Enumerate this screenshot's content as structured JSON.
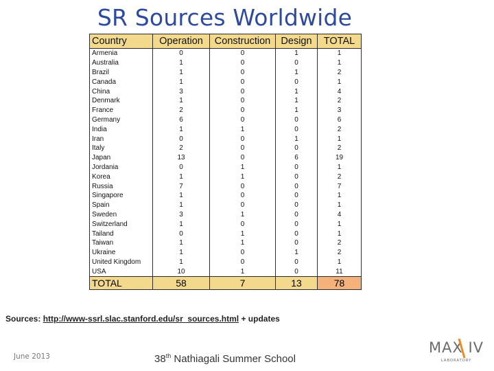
{
  "slide": {
    "title": "SR Sources Worldwide",
    "sources_label": "Sources:",
    "sources_url": "http://www-ssrl.slac.stanford.edu/sr_sources.html",
    "sources_suffix": "+ updates",
    "date": "June 2013",
    "footer_ordinal": "38",
    "footer_sup": "th",
    "footer_text": "Nathiagali Summer School",
    "logo_text": "MAX IV",
    "logo_sub": "LABORATORY"
  },
  "table": {
    "headers": [
      "Country",
      "Operation",
      "Construction",
      "Design",
      "TOTAL"
    ],
    "rows": [
      [
        "Armenia",
        "0",
        "0",
        "1",
        "1"
      ],
      [
        "Australia",
        "1",
        "0",
        "0",
        "1"
      ],
      [
        "Brazil",
        "1",
        "0",
        "1",
        "2"
      ],
      [
        "Canada",
        "1",
        "0",
        "0",
        "1"
      ],
      [
        "China",
        "3",
        "0",
        "1",
        "4"
      ],
      [
        "Denmark",
        "1",
        "0",
        "1",
        "2"
      ],
      [
        "France",
        "2",
        "0",
        "1",
        "3"
      ],
      [
        "Germany",
        "6",
        "0",
        "0",
        "6"
      ],
      [
        "India",
        "1",
        "1",
        "0",
        "2"
      ],
      [
        "Iran",
        "0",
        "0",
        "1",
        "1"
      ],
      [
        "Italy",
        "2",
        "0",
        "0",
        "2"
      ],
      [
        "Japan",
        "13",
        "0",
        "6",
        "19"
      ],
      [
        "Jordania",
        "0",
        "1",
        "0",
        "1"
      ],
      [
        "Korea",
        "1",
        "1",
        "0",
        "2"
      ],
      [
        "Russia",
        "7",
        "0",
        "0",
        "7"
      ],
      [
        "Singapore",
        "1",
        "0",
        "0",
        "1"
      ],
      [
        "Spain",
        "1",
        "0",
        "0",
        "1"
      ],
      [
        "Sweden",
        "3",
        "1",
        "0",
        "4"
      ],
      [
        "Switzerland",
        "1",
        "0",
        "0",
        "1"
      ],
      [
        "Tailand",
        "0",
        "1",
        "0",
        "1"
      ],
      [
        "Taiwan",
        "1",
        "1",
        "0",
        "2"
      ],
      [
        "Ukraine",
        "1",
        "0",
        "1",
        "2"
      ],
      [
        "United Kingdom",
        "1",
        "0",
        "0",
        "1"
      ],
      [
        "USA",
        "10",
        "1",
        "0",
        "11"
      ]
    ],
    "totals": [
      "TOTAL",
      "58",
      "7",
      "13",
      "78"
    ]
  },
  "colors": {
    "title": "#2e4aa0",
    "header_fill": "#f3d98c",
    "grand_total_fill": "#f4b27a"
  }
}
